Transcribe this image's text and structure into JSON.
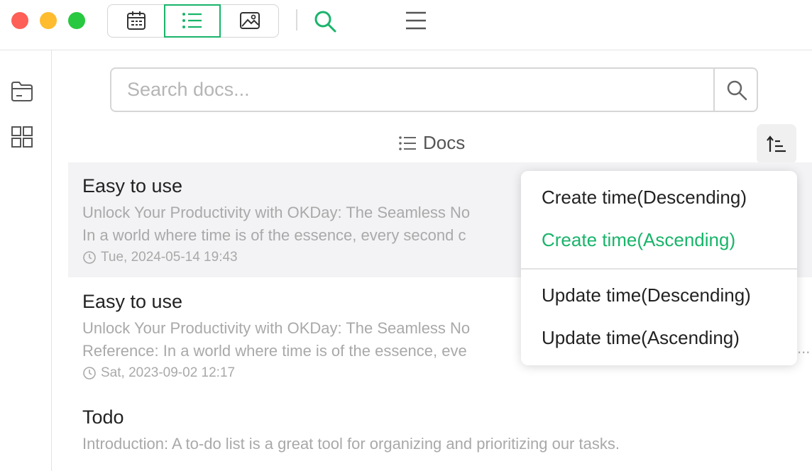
{
  "toolbar": {
    "views": [
      {
        "icon": "calendar-icon",
        "active": false
      },
      {
        "icon": "list-icon",
        "active": true
      },
      {
        "icon": "image-icon",
        "active": false
      }
    ],
    "accent_color": "#19b46a"
  },
  "search": {
    "placeholder": "Search docs...",
    "value": ""
  },
  "docs_header": {
    "title": "Docs"
  },
  "docs": [
    {
      "title": "Easy to use",
      "lines": [
        "Unlock Your Productivity with OKDay: The Seamless No",
        "In a world where time is of the essence, every second c"
      ],
      "time": "Tue, 2024-05-14 19:43",
      "selected": true
    },
    {
      "title": "Easy to use",
      "lines": [
        "Unlock Your Productivity with OKDay: The Seamless No",
        "Reference: In a world where time is of the essence, eve"
      ],
      "time": "Sat, 2023-09-02 12:17",
      "selected": false
    },
    {
      "title": "Todo",
      "lines": [
        "Introduction: A to-do list is a great tool for organizing and prioritizing our tasks."
      ],
      "time": "",
      "selected": false
    }
  ],
  "sort_menu": {
    "items": [
      {
        "label": "Create time(Descending)",
        "active": false
      },
      {
        "label": "Create time(Ascending)",
        "active": true
      },
      {
        "label": "Update time(Descending)",
        "active": false
      },
      {
        "label": "Update time(Ascending)",
        "active": false
      }
    ],
    "truncation_mark": "..."
  }
}
